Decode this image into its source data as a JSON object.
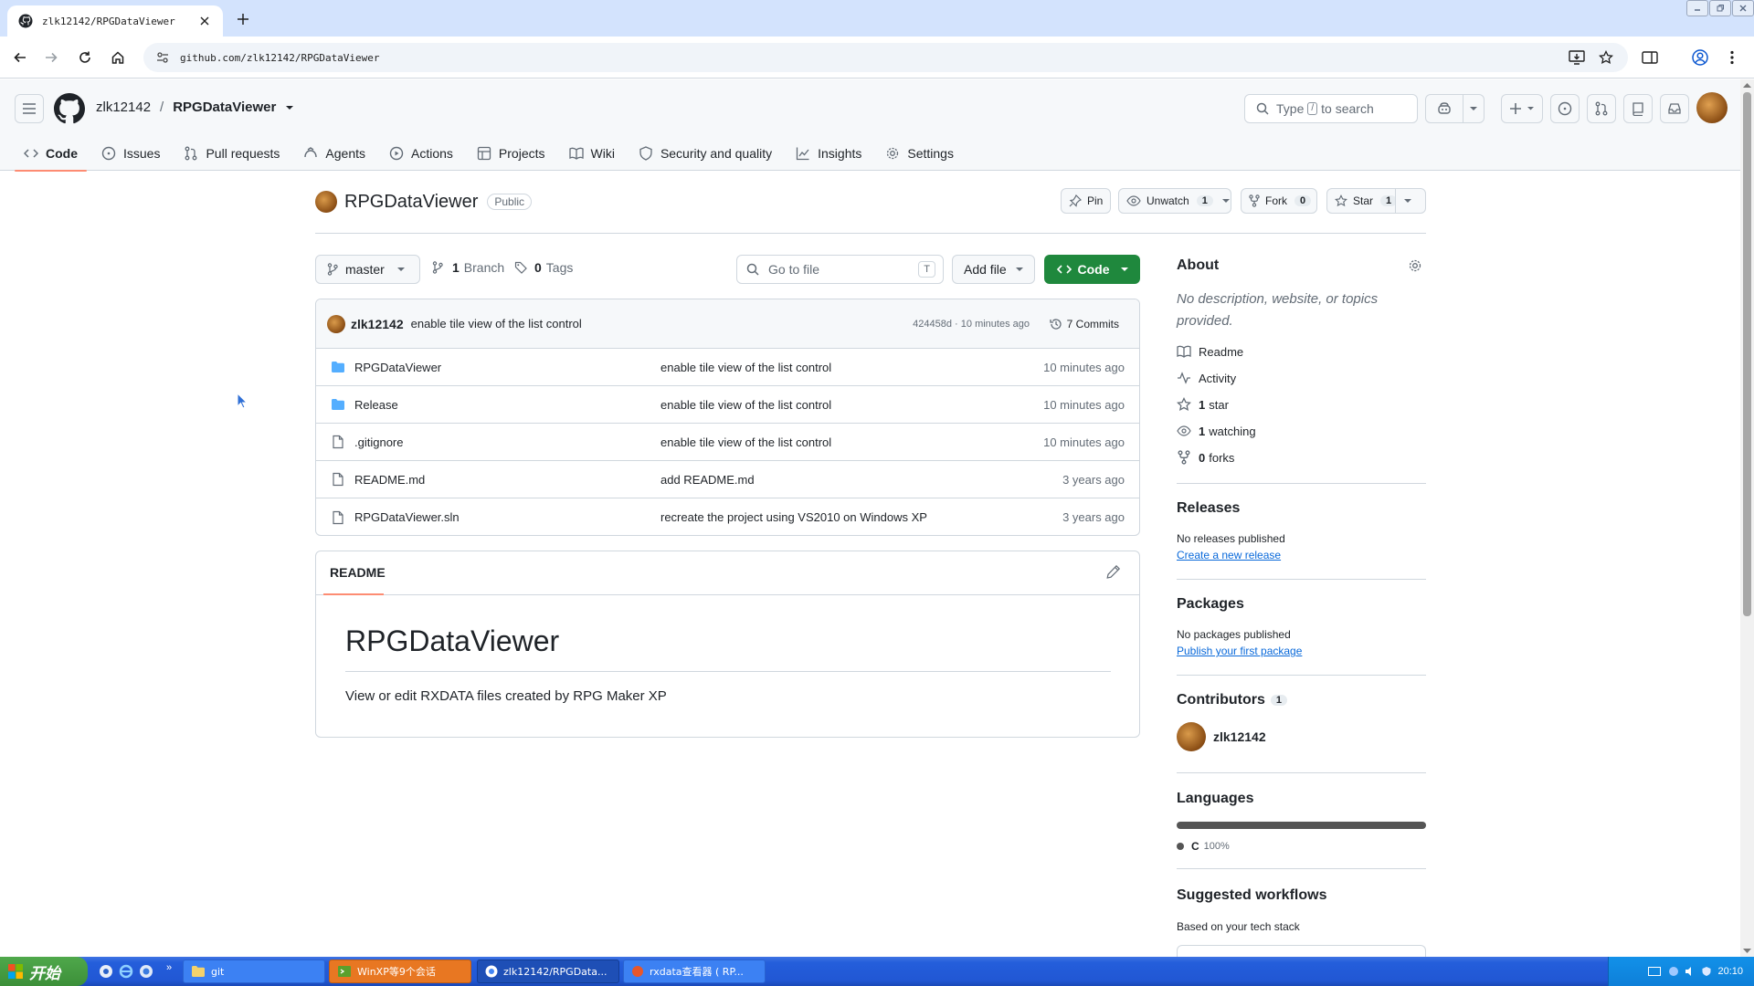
{
  "browser": {
    "tab_title": "zlk12142/RPGDataViewer",
    "url": "github.com/zlk12142/RPGDataViewer"
  },
  "header": {
    "owner": "zlk12142",
    "repo": "RPGDataViewer",
    "search_prefix": "Type",
    "search_key": "/",
    "search_suffix": "to search"
  },
  "repo_tabs": [
    {
      "label": "Code",
      "icon": "code-icon"
    },
    {
      "label": "Issues",
      "icon": "issue-icon"
    },
    {
      "label": "Pull requests",
      "icon": "pull-request-icon"
    },
    {
      "label": "Agents",
      "icon": "agents-icon"
    },
    {
      "label": "Actions",
      "icon": "play-icon"
    },
    {
      "label": "Projects",
      "icon": "table-icon"
    },
    {
      "label": "Wiki",
      "icon": "book-icon"
    },
    {
      "label": "Security and quality",
      "icon": "shield-icon"
    },
    {
      "label": "Insights",
      "icon": "graph-icon"
    },
    {
      "label": "Settings",
      "icon": "gear-icon"
    }
  ],
  "repo": {
    "name": "RPGDataViewer",
    "visibility": "Public",
    "pin_label": "Pin",
    "unwatch_label": "Unwatch",
    "watch_count": "1",
    "fork_label": "Fork",
    "fork_count": "0",
    "star_label": "Star",
    "star_count": "1"
  },
  "branch_bar": {
    "branch": "master",
    "branch_count": "1",
    "branch_label": "Branch",
    "tag_count": "0",
    "tag_label": "Tags",
    "go_to_file_placeholder": "Go to file",
    "go_to_file_key": "T",
    "add_file_label": "Add file",
    "code_label": "Code"
  },
  "latest_commit": {
    "author": "zlk12142",
    "message": "enable tile view of the list control",
    "meta": "424458d · 10 minutes ago",
    "commits_label": "7 Commits"
  },
  "files": [
    {
      "name": "RPGDataViewer",
      "type": "folder",
      "message": "enable tile view of the list control",
      "date": "10 minutes ago"
    },
    {
      "name": "Release",
      "type": "folder",
      "message": "enable tile view of the list control",
      "date": "10 minutes ago"
    },
    {
      "name": ".gitignore",
      "type": "file",
      "message": "enable tile view of the list control",
      "date": "10 minutes ago"
    },
    {
      "name": "README.md",
      "type": "file",
      "message": "add README.md",
      "date": "3 years ago"
    },
    {
      "name": "RPGDataViewer.sln",
      "type": "file",
      "message": "recreate the project using VS2010 on Windows XP",
      "date": "3 years ago"
    }
  ],
  "readme": {
    "tab_label": "README",
    "title": "RPGDataViewer",
    "description": "View or edit RXDATA files created by RPG Maker XP"
  },
  "sidebar": {
    "about_title": "About",
    "about_text": "No description, website, or topics provided.",
    "readme_label": "Readme",
    "activity_label": "Activity",
    "stars_count": "1",
    "stars_label": "star",
    "watching_count": "1",
    "watching_label": "watching",
    "forks_count": "0",
    "forks_label": "forks",
    "releases_title": "Releases",
    "releases_text": "No releases published",
    "releases_link": "Create a new release",
    "packages_title": "Packages",
    "packages_text": "No packages published",
    "packages_link": "Publish your first package",
    "contributors_title": "Contributors",
    "contributors_count": "1",
    "contributor_name": "zlk12142",
    "languages_title": "Languages",
    "language_name": "C",
    "language_percent": "100%",
    "language_fraction": 1.0,
    "language_color": "#555555",
    "workflows_title": "Suggested workflows",
    "workflows_text": "Based on your tech stack"
  },
  "taskbar": {
    "start_label": "开始",
    "tasks": [
      {
        "label": "git"
      },
      {
        "label": "WinXP等9个会话"
      },
      {
        "label": "zlk12142/RPGData..."
      },
      {
        "label": "rxdata查看器 ( RP..."
      }
    ],
    "clock": "20:10"
  },
  "colors": {
    "accent_green": "#1f883d",
    "link_blue": "#0969da",
    "tab_underline": "#fd8c73",
    "folder_blue": "#54aeff"
  }
}
